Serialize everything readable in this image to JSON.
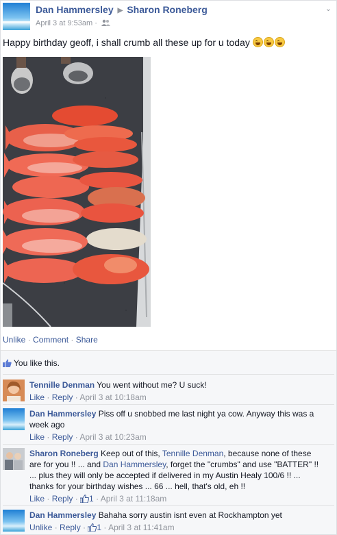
{
  "post": {
    "author": "Dan Hammersley",
    "target": "Sharon Roneberg",
    "timestamp": "April 3 at 9:53am",
    "audience_icon": "friends-icon",
    "text": "Happy birthday geoff, i shall crumb all these up for u today",
    "emojis": [
      "laughing-emoji",
      "laughing-emoji",
      "laughing-emoji"
    ],
    "actions": {
      "unlike": "Unlike",
      "comment": "Comment",
      "share": "Share",
      "separator": "·"
    },
    "likes_text": "You like this."
  },
  "comments": [
    {
      "author": "Tennille Denman",
      "text": "You went without me? U suck!",
      "like": "Like",
      "reply": "Reply",
      "time": "April 3 at 10:18am"
    },
    {
      "author": "Dan Hammersley",
      "text": "Piss off u snobbed me last night ya cow. Anyway this was a week ago",
      "like": "Like",
      "reply": "Reply",
      "time": "April 3 at 10:23am"
    },
    {
      "author": "Sharon Roneberg",
      "text_1": "Keep out of this, ",
      "mention_1": "Tennille Denman",
      "text_2": ", because none of these are for you !! ... and ",
      "mention_2": "Dan Hammersley",
      "text_3": ", forget the \"crumbs\" and use \"BATTER\" !! ... plus they will only be accepted if delivered in my Austin Healy 100/6 !! ... thanks for your birthday wishes ... 66 ... hell, that's old, eh !!",
      "like": "Like",
      "reply": "Reply",
      "like_count": "1",
      "time": "April 3 at 11:18am"
    },
    {
      "author": "Dan Hammersley",
      "text": "Bahaha sorry austin isnt even at Rockhampton yet",
      "like": "Unlike",
      "reply": "Reply",
      "like_count": "1",
      "time": "April 3 at 11:41am"
    }
  ]
}
